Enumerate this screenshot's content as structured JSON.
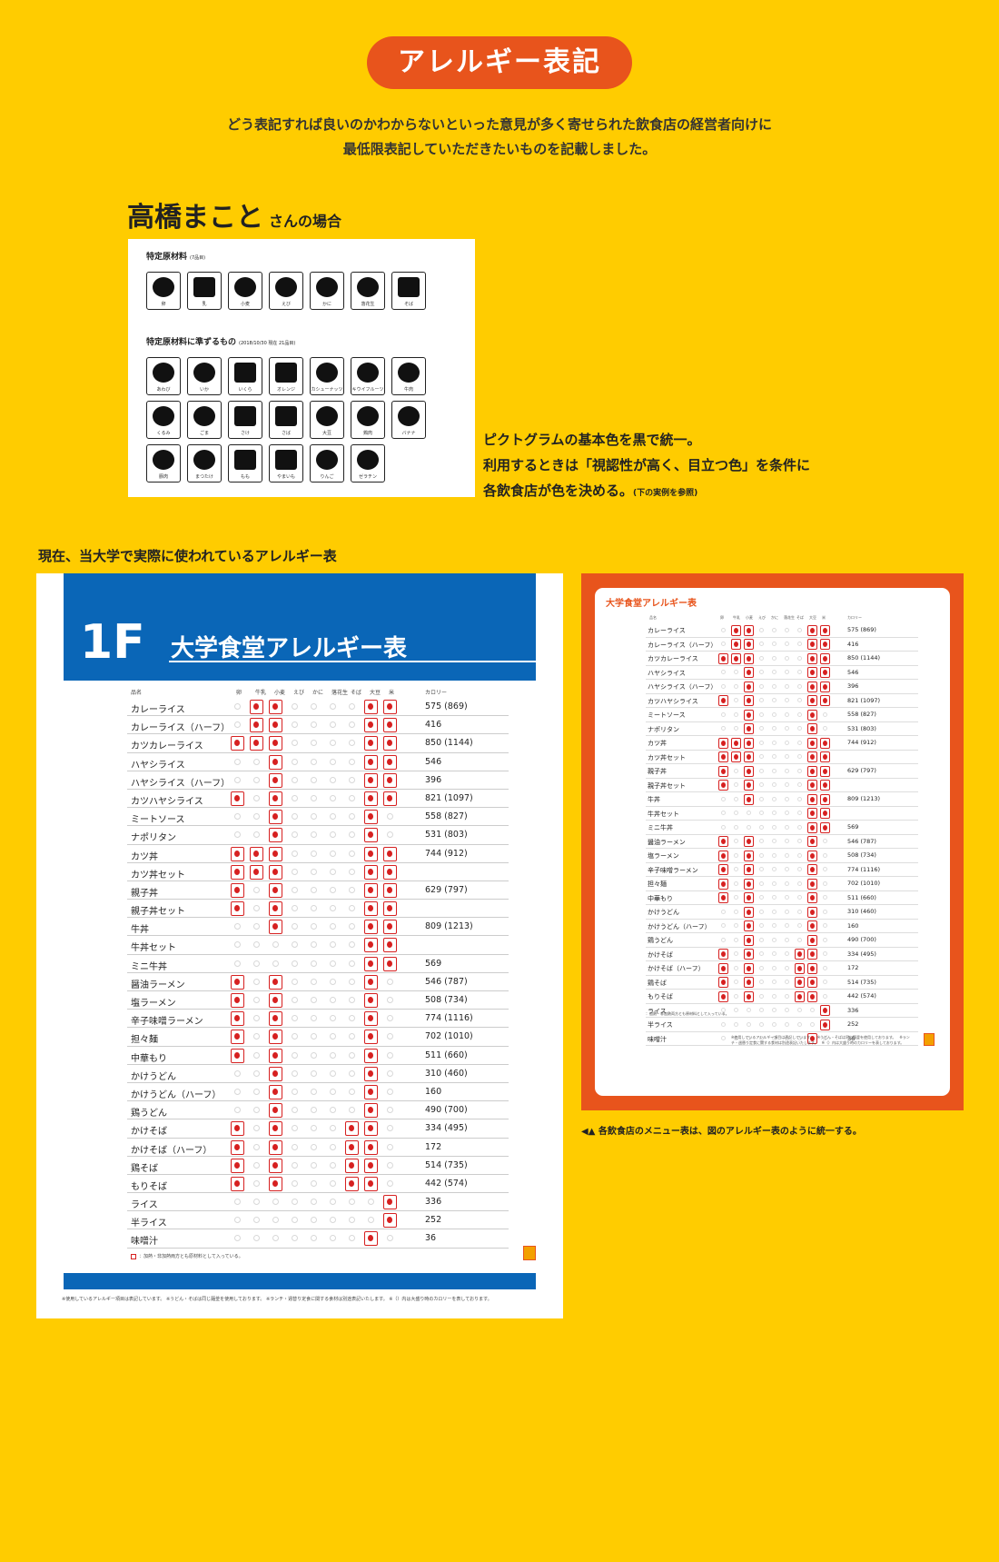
{
  "header": {
    "title": "アレルギー表記",
    "intro_line1": "どう表記すれば良いのかわからないといった意見が多く寄せられた飲食店の経営者向けに",
    "intro_line2": "最低限表記していただきたいものを記載しました。"
  },
  "case": {
    "name": "高橋まこと",
    "suffix": "さんの場合"
  },
  "pictograms": {
    "group1_title": "特定原材料",
    "group1_note": "(7品目)",
    "group1": [
      "卵",
      "乳",
      "小麦",
      "えび",
      "かに",
      "落花生",
      "そば"
    ],
    "group2_title": "特定原材料に準ずるもの",
    "group2_note": "(2018/10/30 現在 21品目)",
    "group2": [
      "あわび",
      "いか",
      "いくら",
      "オレンジ",
      "カシューナッツ",
      "キウイフルーツ",
      "牛肉",
      "くるみ",
      "ごま",
      "さけ",
      "さば",
      "大豆",
      "鶏肉",
      "バナナ",
      "豚肉",
      "まつたけ",
      "もも",
      "やまいも",
      "りんご",
      "ゼラチン"
    ],
    "note_line1": "ピクトグラムの基本色を黒で統一。",
    "note_line2": "利用するときは「視認性が高く、目立つ色」を条件に",
    "note_line3": "各飲食店が色を決める。",
    "note_small": "(下の実例を参照)"
  },
  "section_label": "現在、当大学で実際に使われているアレルギー表",
  "table": {
    "floor": "1F",
    "title": "大学食堂アレルギー表",
    "small_title": "大学食堂アレルギー表",
    "col_name": "品名",
    "col_kcal": "カロリー",
    "allergens": [
      "卵",
      "牛乳",
      "小麦",
      "えび",
      "かに",
      "落花生",
      "そば",
      "大豆",
      "米"
    ],
    "rows": [
      {
        "name": "カレーライス",
        "kcal": "575 (869)",
        "flags": [
          0,
          1,
          1,
          0,
          0,
          0,
          0,
          1,
          1
        ]
      },
      {
        "name": "カレーライス（ハーフ）",
        "kcal": "416",
        "flags": [
          0,
          1,
          1,
          0,
          0,
          0,
          0,
          1,
          1
        ]
      },
      {
        "name": "カツカレーライス",
        "kcal": "850 (1144)",
        "flags": [
          1,
          1,
          1,
          0,
          0,
          0,
          0,
          1,
          1
        ]
      },
      {
        "name": "ハヤシライス",
        "kcal": "546",
        "flags": [
          0,
          0,
          1,
          0,
          0,
          0,
          0,
          1,
          1
        ]
      },
      {
        "name": "ハヤシライス（ハーフ）",
        "kcal": "396",
        "flags": [
          0,
          0,
          1,
          0,
          0,
          0,
          0,
          1,
          1
        ]
      },
      {
        "name": "カツハヤシライス",
        "kcal": "821 (1097)",
        "flags": [
          1,
          0,
          1,
          0,
          0,
          0,
          0,
          1,
          1
        ]
      },
      {
        "name": "ミートソース",
        "kcal": "558 (827)",
        "flags": [
          0,
          0,
          1,
          0,
          0,
          0,
          0,
          1,
          0
        ]
      },
      {
        "name": "ナポリタン",
        "kcal": "531 (803)",
        "flags": [
          0,
          0,
          1,
          0,
          0,
          0,
          0,
          1,
          0
        ]
      },
      {
        "name": "カツ丼",
        "kcal": "744 (912)",
        "flags": [
          1,
          1,
          1,
          0,
          0,
          0,
          0,
          1,
          1
        ]
      },
      {
        "name": "カツ丼セット",
        "kcal": "",
        "flags": [
          1,
          1,
          1,
          0,
          0,
          0,
          0,
          1,
          1
        ]
      },
      {
        "name": "親子丼",
        "kcal": "629 (797)",
        "flags": [
          1,
          0,
          1,
          0,
          0,
          0,
          0,
          1,
          1
        ]
      },
      {
        "name": "親子丼セット",
        "kcal": "",
        "flags": [
          1,
          0,
          1,
          0,
          0,
          0,
          0,
          1,
          1
        ]
      },
      {
        "name": "牛丼",
        "kcal": "809 (1213)",
        "flags": [
          0,
          0,
          1,
          0,
          0,
          0,
          0,
          1,
          1
        ]
      },
      {
        "name": "牛丼セット",
        "kcal": "",
        "flags": [
          0,
          0,
          0,
          0,
          0,
          0,
          0,
          1,
          1
        ]
      },
      {
        "name": "ミニ牛丼",
        "kcal": "569",
        "flags": [
          0,
          0,
          0,
          0,
          0,
          0,
          0,
          1,
          1
        ]
      },
      {
        "name": "醤油ラーメン",
        "kcal": "546 (787)",
        "flags": [
          1,
          0,
          1,
          0,
          0,
          0,
          0,
          1,
          0
        ]
      },
      {
        "name": "塩ラーメン",
        "kcal": "508 (734)",
        "flags": [
          1,
          0,
          1,
          0,
          0,
          0,
          0,
          1,
          0
        ]
      },
      {
        "name": "辛子味噌ラーメン",
        "kcal": "774 (1116)",
        "flags": [
          1,
          0,
          1,
          0,
          0,
          0,
          0,
          1,
          0
        ]
      },
      {
        "name": "担々麺",
        "kcal": "702 (1010)",
        "flags": [
          1,
          0,
          1,
          0,
          0,
          0,
          0,
          1,
          0
        ]
      },
      {
        "name": "中華もり",
        "kcal": "511 (660)",
        "flags": [
          1,
          0,
          1,
          0,
          0,
          0,
          0,
          1,
          0
        ]
      },
      {
        "name": "かけうどん",
        "kcal": "310 (460)",
        "flags": [
          0,
          0,
          1,
          0,
          0,
          0,
          0,
          1,
          0
        ]
      },
      {
        "name": "かけうどん（ハーフ）",
        "kcal": "160",
        "flags": [
          0,
          0,
          1,
          0,
          0,
          0,
          0,
          1,
          0
        ]
      },
      {
        "name": "鶏うどん",
        "kcal": "490 (700)",
        "flags": [
          0,
          0,
          1,
          0,
          0,
          0,
          0,
          1,
          0
        ]
      },
      {
        "name": "かけそば",
        "kcal": "334 (495)",
        "flags": [
          1,
          0,
          1,
          0,
          0,
          0,
          1,
          1,
          0
        ]
      },
      {
        "name": "かけそば（ハーフ）",
        "kcal": "172",
        "flags": [
          1,
          0,
          1,
          0,
          0,
          0,
          1,
          1,
          0
        ]
      },
      {
        "name": "鶏そば",
        "kcal": "514 (735)",
        "flags": [
          1,
          0,
          1,
          0,
          0,
          0,
          1,
          1,
          0
        ]
      },
      {
        "name": "もりそば",
        "kcal": "442 (574)",
        "flags": [
          1,
          0,
          1,
          0,
          0,
          0,
          1,
          1,
          0
        ]
      },
      {
        "name": "ライス",
        "kcal": "336",
        "flags": [
          0,
          0,
          0,
          0,
          0,
          0,
          0,
          0,
          1
        ]
      },
      {
        "name": "半ライス",
        "kcal": "252",
        "flags": [
          0,
          0,
          0,
          0,
          0,
          0,
          0,
          0,
          1
        ]
      },
      {
        "name": "味噌汁",
        "kcal": "36",
        "flags": [
          0,
          0,
          0,
          0,
          0,
          0,
          0,
          1,
          0
        ]
      }
    ],
    "legend": "：加熱・非加熱両方とも原材料として入っている。",
    "footnote": "※使用しているアレルギー項目は表記しています。 ※うどん・そばは同じ麺釜を使用しております。 ※ランチ・週替り定食に関する食材は別途表記いたします。 ※（）内は大盛り時のカロリーを表しております。",
    "small_foot": "※使用しているアレルギー項目は表記しています。　※うどん・そばは同じ麺釜を使用しております。　※ランチ・週替り定食に関する食材は別途表記いたします。　※（）内は大盛り時のカロリーを表しております。"
  },
  "caption": "◀▲ 各飲食店のメニュー表は、図のアレルギー表のように統一する。",
  "colors": {
    "background": "#FFCC00",
    "accent": "#E8541C",
    "banner_blue": "#0A66B7",
    "allergy_red": "#D62020"
  }
}
